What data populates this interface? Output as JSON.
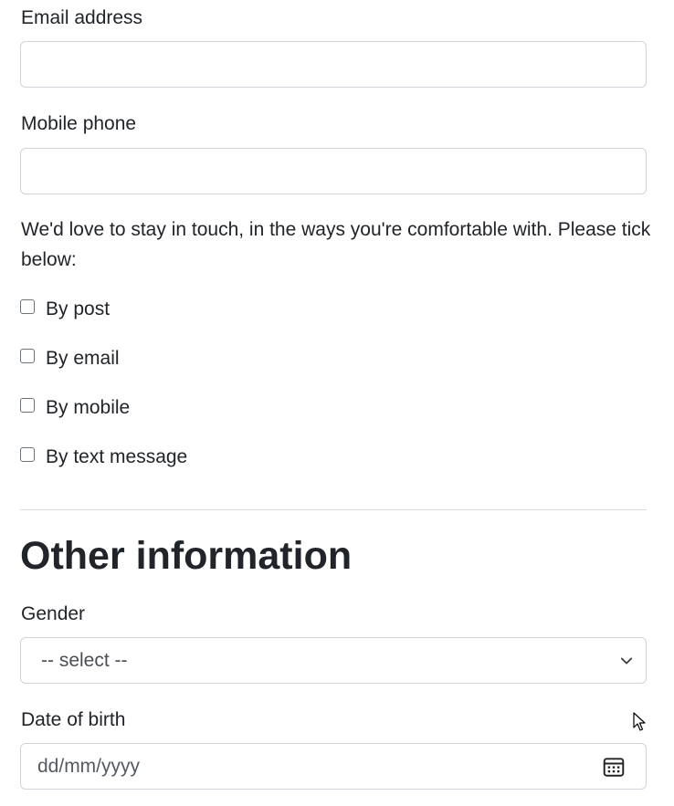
{
  "form": {
    "email_label": "Email address",
    "email_value": "",
    "mobile_label": "Mobile phone",
    "mobile_value": "",
    "contact_intro": "We'd love to stay in touch, in the ways you're comfortable with. Please tick below:",
    "contact_options": [
      {
        "label": "By post",
        "checked": false
      },
      {
        "label": "By email",
        "checked": false
      },
      {
        "label": "By mobile",
        "checked": false
      },
      {
        "label": "By text message",
        "checked": false
      }
    ],
    "other_heading": "Other information",
    "gender_label": "Gender",
    "gender_selected": "-- select --",
    "dob_label": "Date of birth",
    "dob_placeholder": "dd/mm/yyyy"
  },
  "icons": {
    "select": "chevron-down-icon",
    "date": "calendar-icon",
    "pointer": "mouse-cursor-icon"
  },
  "colors": {
    "text": "#212529",
    "border": "#ced4da",
    "divider": "#dcdcdc"
  }
}
